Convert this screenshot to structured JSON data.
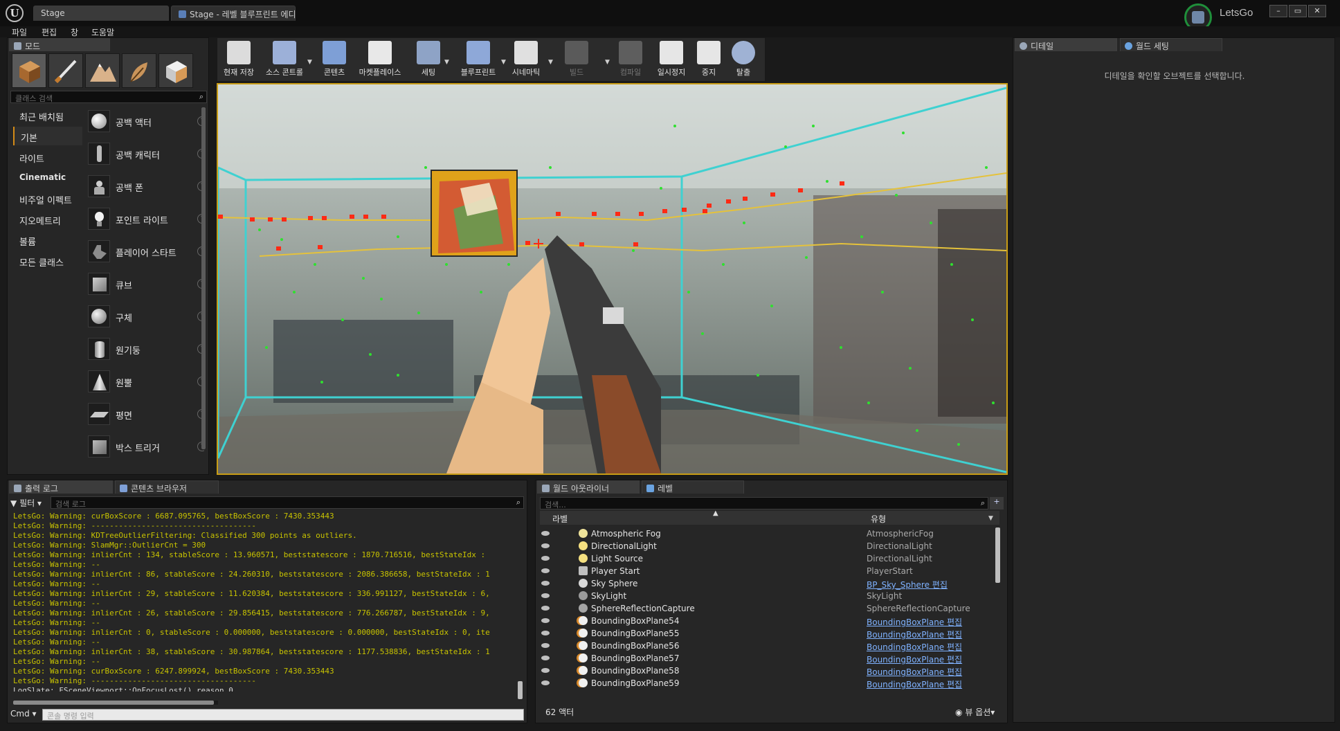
{
  "window": {
    "tabs": [
      {
        "label": "Stage"
      },
      {
        "label": "Stage - 레벨 블루프린트 에디"
      }
    ],
    "project_name": "LetsGo"
  },
  "menu": [
    "파일",
    "편집",
    "창",
    "도움말"
  ],
  "modes": {
    "tab_label": "모드",
    "search_placeholder": "클래스 검색",
    "categories": [
      "최근 배치됨",
      "기본",
      "라이트",
      "Cinematic",
      "비주얼 이펙트",
      "지오메트리",
      "볼륨",
      "모든 클래스"
    ],
    "active_category": "기본",
    "items": [
      "공백 액터",
      "공백 캐릭터",
      "공백 폰",
      "포인트 라이트",
      "플레이어 스타트",
      "큐브",
      "구체",
      "원기둥",
      "원뿔",
      "평면",
      "박스 트리거"
    ]
  },
  "toolbar": {
    "buttons": [
      "현재 저장",
      "소스 콘트롤",
      "콘텐츠",
      "마켓플레이스",
      "세팅",
      "블루프린트",
      "시네마틱",
      "빌드",
      "컴파일",
      "일시정지",
      "중지",
      "탈출"
    ]
  },
  "details": {
    "tabs": [
      "디테일",
      "월드 세팅"
    ],
    "empty_message": "디테일을 확인할 오브젝트를 선택합니다."
  },
  "output_log": {
    "tabs": [
      "출력 로그",
      "콘텐츠 브라우저"
    ],
    "filter_label": "필터",
    "search_placeholder": "검색 로그",
    "lines": [
      "LetsGo: Warning: curBoxScore : 6687.095765, bestBoxScore : 7430.353443",
      "LetsGo: Warning: ------------------------------------",
      "LetsGo: Warning: KDTreeOutlierFiltering: Classified 300 points as outliers.",
      "LetsGo: Warning: SlamMgr::OutlierCnt = 300",
      "LetsGo: Warning: inlierCnt : 134, stableScore : 13.960571, beststatescore : 1870.716516, bestStateIdx :",
      "LetsGo: Warning: --",
      "LetsGo: Warning: inlierCnt : 86, stableScore : 24.260310, beststatescore : 2086.386658, bestStateIdx : 1",
      "LetsGo: Warning: --",
      "LetsGo: Warning: inlierCnt : 29, stableScore : 11.620384, beststatescore : 336.991127, bestStateIdx : 6,",
      "LetsGo: Warning: --",
      "LetsGo: Warning: inlierCnt : 26, stableScore : 29.856415, beststatescore : 776.266787, bestStateIdx : 9,",
      "LetsGo: Warning: --",
      "LetsGo: Warning: inlierCnt : 0, stableScore : 0.000000, beststatescore : 0.000000, bestStateIdx : 0, ite",
      "LetsGo: Warning: --",
      "LetsGo: Warning: inlierCnt : 38, stableScore : 30.987864, beststatescore : 1177.538836, bestStateIdx : 1",
      "LetsGo: Warning: --",
      "LetsGo: Warning: curBoxScore : 6247.899924, bestBoxScore : 7430.353443",
      "LetsGo: Warning: ------------------------------------",
      "LogSlate: FSceneViewport::OnFocusLost() reason 0"
    ],
    "cmd_label": "Cmd",
    "console_placeholder": "콘솔 명령 입력"
  },
  "outliner": {
    "tabs": [
      "월드 아웃라이너",
      "레벨"
    ],
    "search_placeholder": "검색...",
    "col_label": "라벨",
    "col_type": "유형",
    "rows": [
      {
        "name": "Atmospheric Fog",
        "type": "AtmosphericFog",
        "link": false
      },
      {
        "name": "DirectionalLight",
        "type": "DirectionalLight",
        "link": false
      },
      {
        "name": "Light Source",
        "type": "DirectionalLight",
        "link": false
      },
      {
        "name": "Player Start",
        "type": "PlayerStart",
        "link": false
      },
      {
        "name": "Sky Sphere",
        "type": "BP_Sky_Sphere 편집",
        "link": true
      },
      {
        "name": "SkyLight",
        "type": "SkyLight",
        "link": false
      },
      {
        "name": "SphereReflectionCapture",
        "type": "SphereReflectionCapture",
        "link": false
      },
      {
        "name": "BoundingBoxPlane54",
        "type": "BoundingBoxPlane 편집",
        "link": true
      },
      {
        "name": "BoundingBoxPlane55",
        "type": "BoundingBoxPlane 편집",
        "link": true
      },
      {
        "name": "BoundingBoxPlane56",
        "type": "BoundingBoxPlane 편집",
        "link": true
      },
      {
        "name": "BoundingBoxPlane57",
        "type": "BoundingBoxPlane 편집",
        "link": true
      },
      {
        "name": "BoundingBoxPlane58",
        "type": "BoundingBoxPlane 편집",
        "link": true
      },
      {
        "name": "BoundingBoxPlane59",
        "type": "BoundingBoxPlane 편집",
        "link": true
      }
    ],
    "actor_count": "62 액터",
    "view_options": "뷰 옵션"
  }
}
